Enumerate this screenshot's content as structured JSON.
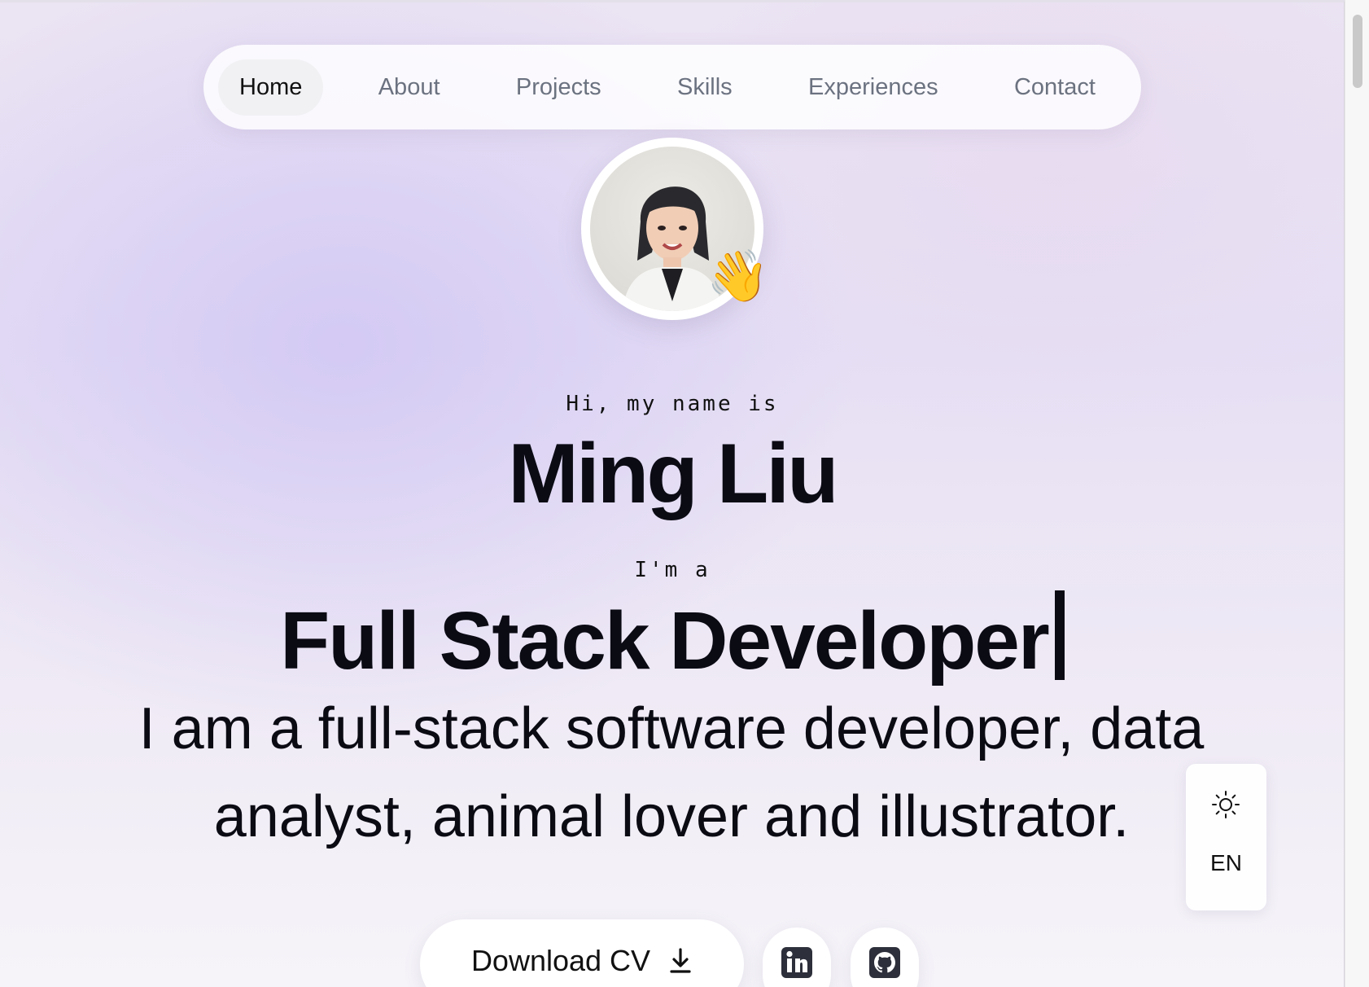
{
  "nav": {
    "items": [
      {
        "label": "Home",
        "active": true
      },
      {
        "label": "About"
      },
      {
        "label": "Projects"
      },
      {
        "label": "Skills"
      },
      {
        "label": "Experiences"
      },
      {
        "label": "Contact"
      }
    ]
  },
  "hero": {
    "greeting": "Hi, my name is",
    "name": "Ming Liu",
    "intro": "I'm a",
    "role": "Full Stack Developer",
    "description": "I am a full-stack software developer, data analyst, animal lover and illustrator."
  },
  "settings": {
    "theme_icon": "sun-icon",
    "language": "EN"
  },
  "actions": {
    "download_cv_label": "Download CV",
    "download_icon": "download-icon",
    "linkedin_icon": "linkedin-icon",
    "github_icon": "github-icon"
  },
  "colors": {
    "text": "#0b0b14",
    "nav_inactive": "#6b7280",
    "accent_bg": "#e6dff4"
  }
}
